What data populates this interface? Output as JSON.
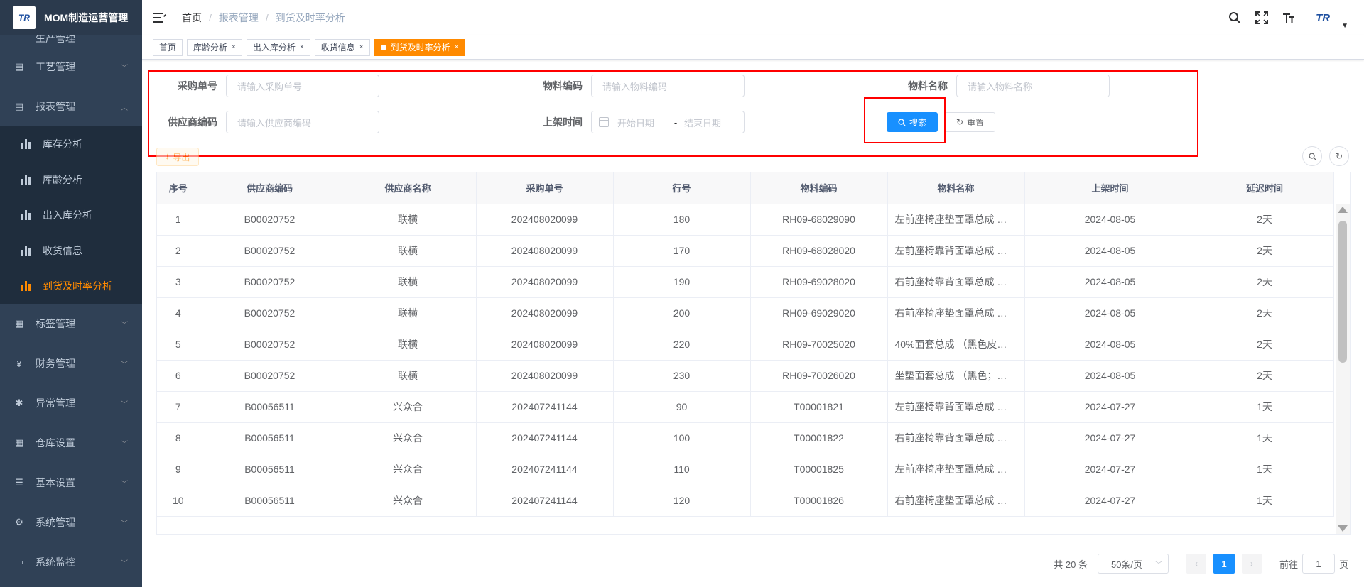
{
  "app": {
    "logo_text": "TR",
    "title": "MOM制造运营管理"
  },
  "sidebar": {
    "partial_top_label": "生产管理",
    "items_top": [
      {
        "label": "工艺管理",
        "icon": "layers-icon"
      },
      {
        "label": "报表管理",
        "icon": "report-icon",
        "expanded": true
      }
    ],
    "report_sub": [
      {
        "label": "库存分析"
      },
      {
        "label": "库龄分析"
      },
      {
        "label": "出入库分析"
      },
      {
        "label": "收货信息"
      },
      {
        "label": "到货及时率分析",
        "active": true
      }
    ],
    "items_bottom": [
      {
        "label": "标签管理",
        "icon": "grid-icon"
      },
      {
        "label": "财务管理",
        "icon": "yen-icon"
      },
      {
        "label": "异常管理",
        "icon": "bug-icon"
      },
      {
        "label": "仓库设置",
        "icon": "grid-icon"
      },
      {
        "label": "基本设置",
        "icon": "sliders-icon"
      },
      {
        "label": "系统管理",
        "icon": "gear-icon"
      },
      {
        "label": "系统监控",
        "icon": "monitor-icon"
      }
    ]
  },
  "breadcrumb": {
    "home": "首页",
    "level1": "报表管理",
    "current": "到货及时率分析"
  },
  "tags": [
    {
      "label": "首页",
      "closable": false
    },
    {
      "label": "库龄分析",
      "closable": true
    },
    {
      "label": "出入库分析",
      "closable": true
    },
    {
      "label": "收货信息",
      "closable": true
    },
    {
      "label": "到货及时率分析",
      "closable": true,
      "active": true
    }
  ],
  "header_user": {
    "avatar_text": "TR"
  },
  "form": {
    "po_label": "采购单号",
    "po_placeholder": "请输入采购单号",
    "material_code_label": "物料编码",
    "material_code_placeholder": "请输入物料编码",
    "material_name_label": "物料名称",
    "material_name_placeholder": "请输入物料名称",
    "supplier_code_label": "供应商编码",
    "supplier_code_placeholder": "请输入供应商编码",
    "shelf_time_label": "上架时间",
    "start_placeholder": "开始日期",
    "range_sep": "-",
    "end_placeholder": "结束日期",
    "search_label": "搜索",
    "reset_label": "重置"
  },
  "toolbar": {
    "export_label": "导出"
  },
  "table": {
    "columns": [
      "序号",
      "供应商编码",
      "供应商名称",
      "采购单号",
      "行号",
      "物料编码",
      "物料名称",
      "上架时间",
      "延迟时间"
    ],
    "rows": [
      [
        "1",
        "B00020752",
        "联横",
        "202408020099",
        "180",
        "RH09-68029090",
        "左前座椅座垫面罩总成 …",
        "2024-08-05",
        "2天"
      ],
      [
        "2",
        "B00020752",
        "联横",
        "202408020099",
        "170",
        "RH09-68028020",
        "左前座椅靠背面罩总成 …",
        "2024-08-05",
        "2天"
      ],
      [
        "3",
        "B00020752",
        "联横",
        "202408020099",
        "190",
        "RH09-69028020",
        "右前座椅靠背面罩总成 …",
        "2024-08-05",
        "2天"
      ],
      [
        "4",
        "B00020752",
        "联横",
        "202408020099",
        "200",
        "RH09-69029020",
        "右前座椅座垫面罩总成 …",
        "2024-08-05",
        "2天"
      ],
      [
        "5",
        "B00020752",
        "联横",
        "202408020099",
        "220",
        "RH09-70025020",
        "40%面套总成 （黑色皮…",
        "2024-08-05",
        "2天"
      ],
      [
        "6",
        "B00020752",
        "联横",
        "202408020099",
        "230",
        "RH09-70026020",
        "坐垫面套总成 （黑色；…",
        "2024-08-05",
        "2天"
      ],
      [
        "7",
        "B00056511",
        "兴众合",
        "202407241144",
        "90",
        "T00001821",
        "左前座椅靠背面罩总成 …",
        "2024-07-27",
        "1天"
      ],
      [
        "8",
        "B00056511",
        "兴众合",
        "202407241144",
        "100",
        "T00001822",
        "右前座椅靠背面罩总成 …",
        "2024-07-27",
        "1天"
      ],
      [
        "9",
        "B00056511",
        "兴众合",
        "202407241144",
        "110",
        "T00001825",
        "左前座椅座垫面罩总成 …",
        "2024-07-27",
        "1天"
      ],
      [
        "10",
        "B00056511",
        "兴众合",
        "202407241144",
        "120",
        "T00001826",
        "右前座椅座垫面罩总成 …",
        "2024-07-27",
        "1天"
      ]
    ]
  },
  "pagination": {
    "total": "共 20 条",
    "page_size": "50条/页",
    "current_page": "1",
    "goto_label": "前往",
    "goto_value": "1",
    "page_suffix": "页"
  }
}
